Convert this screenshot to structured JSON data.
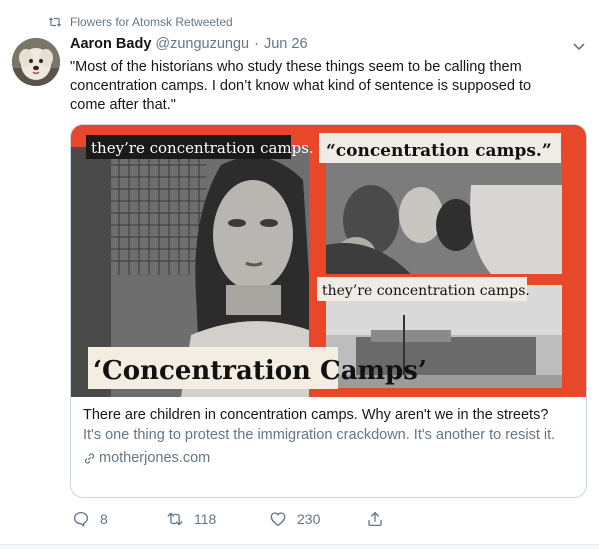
{
  "retweet": {
    "icon": "retweet-icon",
    "text": "Flowers for Atomsk Retweeted"
  },
  "author": {
    "name": "Aaron Bady",
    "handle": "@zunguzungu",
    "separator": "·",
    "date": "Jun 26"
  },
  "tweet_text": "\"Most of the historians who study these things seem to be calling them concentration camps. I don’t know what kind of sentence is supposed to come after that.\"",
  "card": {
    "image": {
      "label_1": "they’re concentration camps.",
      "label_2": "“concentration camps.”",
      "label_3": "they’re concentration camps.",
      "headline": "‘Concentration Camps’"
    },
    "title": "There are children in concentration camps. Why aren't we in the streets?",
    "description": "It's one thing to protest the immigration crackdown. It's another to resist it.",
    "domain": "motherjones.com"
  },
  "actions": {
    "replies": "8",
    "retweets": "118",
    "likes": "230"
  },
  "colors": {
    "accent": "#1da1f2",
    "muted": "#657786",
    "image_bg": "#e8472a",
    "border": "#ccd6dd"
  }
}
